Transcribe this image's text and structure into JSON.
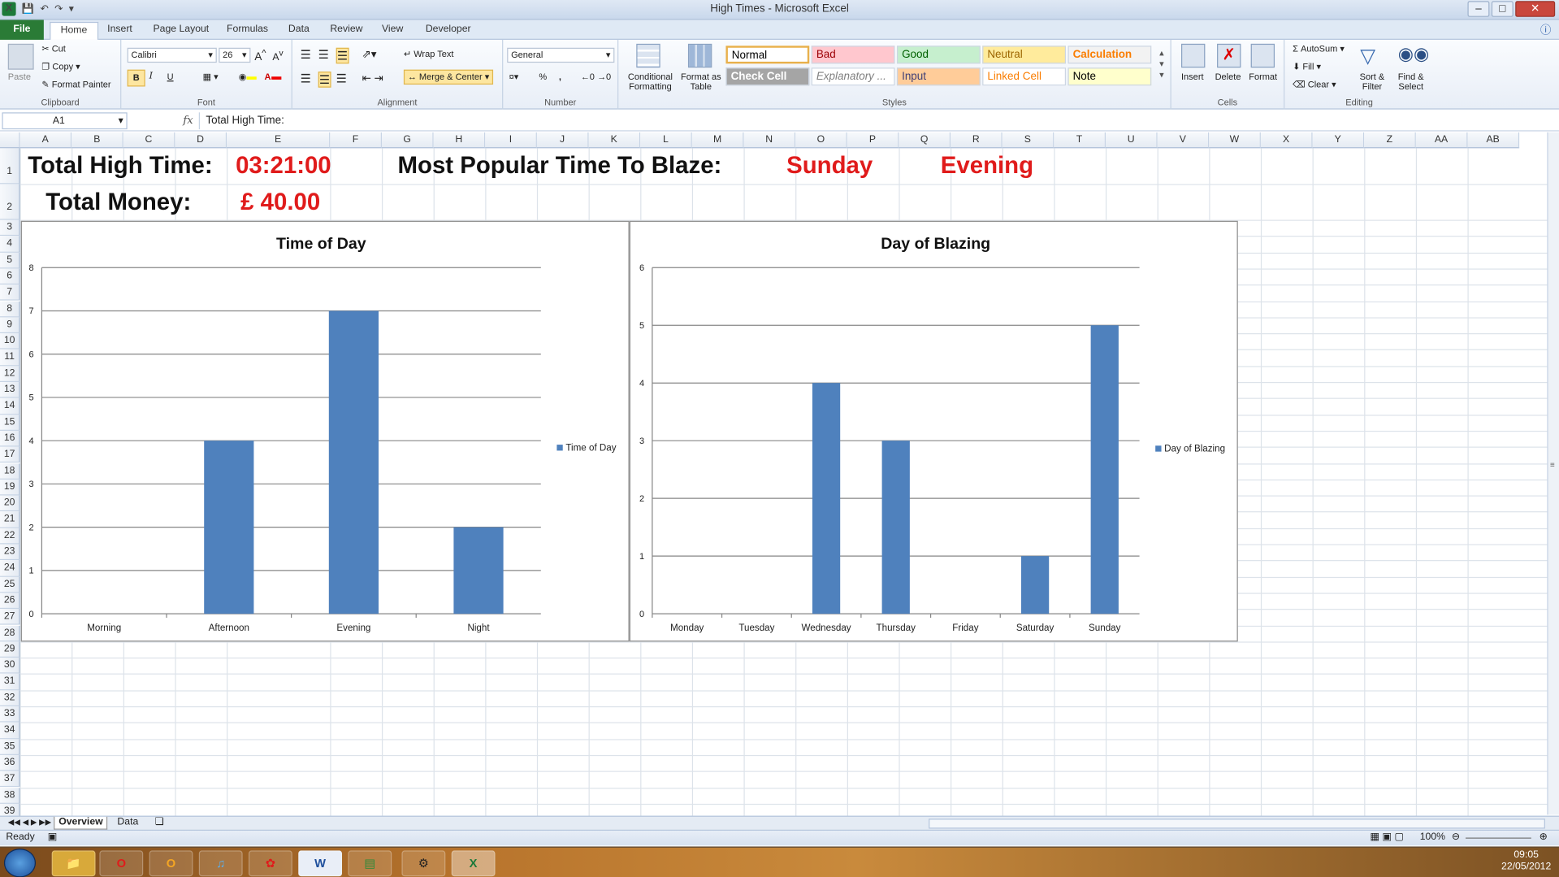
{
  "window": {
    "title": "High Times - Microsoft Excel"
  },
  "ribbon_tabs": [
    "File",
    "Home",
    "Insert",
    "Page Layout",
    "Formulas",
    "Data",
    "Review",
    "View",
    "Developer"
  ],
  "clipboard": {
    "paste": "Paste",
    "cut": "Cut",
    "copy": "Copy",
    "format_painter": "Format Painter",
    "label": "Clipboard"
  },
  "font": {
    "name": "Calibri",
    "size": "26",
    "bold": "B",
    "italic": "I",
    "underline": "U",
    "label": "Font"
  },
  "alignment": {
    "wrap": "Wrap Text",
    "merge": "Merge & Center",
    "label": "Alignment"
  },
  "number": {
    "format": "General",
    "percent": "%",
    "comma": ",",
    "label": "Number"
  },
  "styles": {
    "cond": "Conditional Formatting",
    "table": "Format as Table",
    "label": "Styles",
    "cells": [
      {
        "name": "Normal",
        "bg": "#ffffff",
        "fg": "#000000"
      },
      {
        "name": "Bad",
        "bg": "#ffc7ce",
        "fg": "#9c0006"
      },
      {
        "name": "Good",
        "bg": "#c6efce",
        "fg": "#006100"
      },
      {
        "name": "Neutral",
        "bg": "#ffeb9c",
        "fg": "#9c6500"
      },
      {
        "name": "Calculation",
        "bg": "#f2f2f2",
        "fg": "#fa7d00"
      },
      {
        "name": "Check Cell",
        "bg": "#a5a5a5",
        "fg": "#ffffff"
      },
      {
        "name": "Explanatory ...",
        "bg": "#ffffff",
        "fg": "#7f7f7f"
      },
      {
        "name": "Input",
        "bg": "#ffcc99",
        "fg": "#3f3f76"
      },
      {
        "name": "Linked Cell",
        "bg": "#ffffff",
        "fg": "#fa7d00"
      },
      {
        "name": "Note",
        "bg": "#ffffcc",
        "fg": "#000000"
      }
    ]
  },
  "cells_grp": {
    "insert": "Insert",
    "delete": "Delete",
    "format": "Format",
    "label": "Cells"
  },
  "editing": {
    "autosum": "AutoSum",
    "fill": "Fill",
    "clear": "Clear",
    "sort": "Sort & Filter",
    "find": "Find & Select",
    "label": "Editing"
  },
  "formula_bar": {
    "name_box": "A1",
    "fx": "fx",
    "content": "Total High Time:"
  },
  "columns": [
    "A",
    "B",
    "C",
    "D",
    "E",
    "F",
    "G",
    "H",
    "I",
    "J",
    "K",
    "L",
    "M",
    "N",
    "O",
    "P",
    "Q",
    "R",
    "S",
    "T",
    "U",
    "V",
    "W",
    "X",
    "Y",
    "Z",
    "AA",
    "AB"
  ],
  "rows": [
    "1",
    "2",
    "3",
    "4",
    "5",
    "6",
    "7",
    "8",
    "9",
    "10",
    "11",
    "12",
    "13",
    "14",
    "15",
    "16",
    "17",
    "18",
    "19",
    "20",
    "21",
    "22",
    "23",
    "24",
    "25",
    "26",
    "27",
    "28",
    "29",
    "30",
    "31",
    "32",
    "33",
    "34",
    "35",
    "36",
    "37",
    "38",
    "39"
  ],
  "summary": {
    "total_high_time_label": "Total High Time:",
    "total_high_time": "03:21:00",
    "total_money_label": "Total Money:",
    "total_money": "£ 40.00",
    "popular_label": "Most Popular Time To Blaze:",
    "popular_day": "Sunday",
    "popular_time": "Evening"
  },
  "chart_data": [
    {
      "type": "bar",
      "title": "Time of Day",
      "categories": [
        "Morning",
        "Afternoon",
        "Evening",
        "Night"
      ],
      "series": [
        {
          "name": "Time of Day",
          "values": [
            0,
            4,
            7,
            2
          ]
        }
      ],
      "ylim": [
        0,
        8
      ],
      "yticks": [
        "0",
        "1",
        "2",
        "3",
        "4",
        "5",
        "6",
        "7",
        "8"
      ],
      "grid": true,
      "legend": "right",
      "color": "#4f81bd"
    },
    {
      "type": "bar",
      "title": "Day of Blazing",
      "categories": [
        "Monday",
        "Tuesday",
        "Wednesday",
        "Thursday",
        "Friday",
        "Saturday",
        "Sunday"
      ],
      "series": [
        {
          "name": "Day of Blazing",
          "values": [
            0,
            0,
            4,
            3,
            0,
            1,
            5
          ]
        }
      ],
      "ylim": [
        0,
        6
      ],
      "yticks": [
        "0",
        "1",
        "2",
        "3",
        "4",
        "5",
        "6"
      ],
      "grid": true,
      "legend": "right",
      "color": "#4f81bd"
    }
  ],
  "sheet_tabs": [
    "Overview",
    "Data"
  ],
  "status": {
    "ready": "Ready",
    "zoom": "100%"
  },
  "tray": {
    "time": "09:05",
    "date": "22/05/2012"
  }
}
